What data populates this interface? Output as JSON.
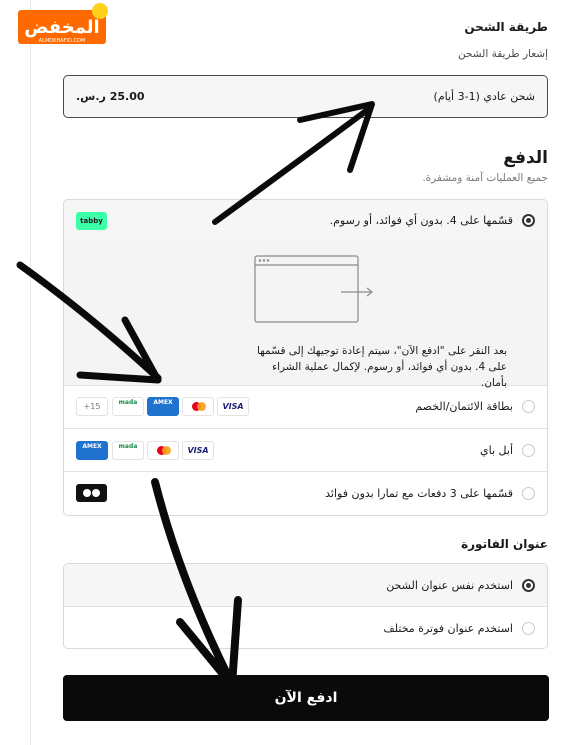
{
  "logo": {
    "text": "المخفض",
    "subtext": "ALMOKHAFID.COM"
  },
  "shipping": {
    "title": "طريقة الشحن",
    "notice": "إشعار طريقة الشحن",
    "method_name": "شحن عادي (1-3 أيام)",
    "method_price": "25.00 ر.س."
  },
  "payment": {
    "title": "الدفع",
    "subtitle": "جميع العمليات آمنة ومشفرة.",
    "options": [
      {
        "label": "قسّمها على 4. بدون أي فوائد، أو رسوم.",
        "badge": "tabby",
        "selected": true
      },
      {
        "label": "بطاقة الائتمان/الخصم",
        "brands": [
          "VISA",
          "mastercard",
          "AMEX",
          "mada",
          "+15"
        ],
        "selected": false
      },
      {
        "label": "أبل باي",
        "brands": [
          "VISA",
          "mastercard",
          "mada",
          "AMEX"
        ],
        "selected": false
      },
      {
        "label": "قسّمها على 3 دفعات مع تمارا بدون فوائد",
        "badge": "tamara",
        "selected": false
      }
    ],
    "redirect_text": "بعد النقر على \"ادفع الآن\"، سيتم إعادة توجيهك إلى قسّمها على 4. بدون أي فوائد، أو رسوم. لإكمال عملية الشراء بأمان."
  },
  "billing": {
    "title": "عنوان الفاتورة",
    "options": [
      {
        "label": "استخدم نفس عنوان الشحن",
        "selected": true
      },
      {
        "label": "استخدم عنوان فوترة مختلف",
        "selected": false
      }
    ]
  },
  "pay_button": "ادفع الآن",
  "colors": {
    "accent": "#0a0a0a",
    "tabby": "#3bffa9",
    "logo": "#ff6a00"
  },
  "icons": [
    "tabby-badge",
    "browser-redirect-icon",
    "visa-icon",
    "mastercard-icon",
    "amex-icon",
    "mada-icon",
    "tamara-icon"
  ]
}
